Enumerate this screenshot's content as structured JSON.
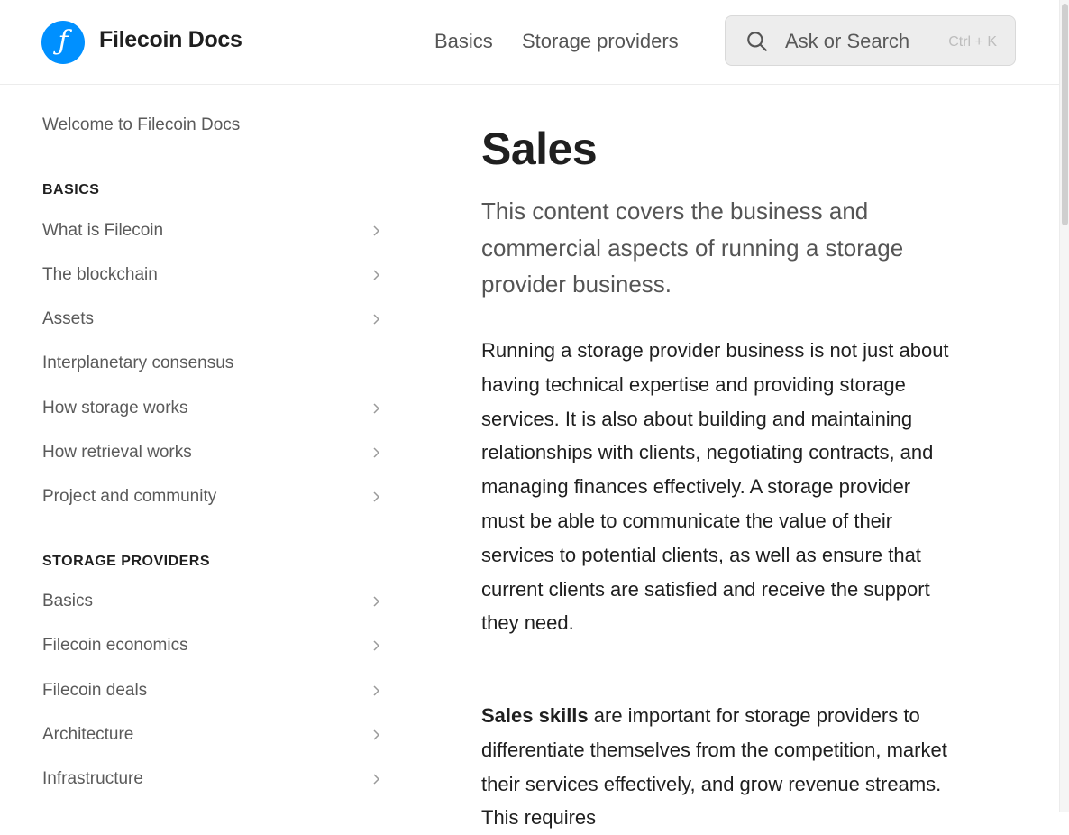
{
  "header": {
    "brand": "Filecoin Docs",
    "logo_glyph": "ƒ",
    "nav": [
      "Basics",
      "Storage providers"
    ],
    "search_placeholder": "Ask or Search",
    "search_shortcut": "Ctrl + K"
  },
  "sidebar": {
    "welcome": "Welcome to Filecoin Docs",
    "sections": [
      {
        "heading": "BASICS",
        "items": [
          {
            "label": "What is Filecoin",
            "has_children": true
          },
          {
            "label": "The blockchain",
            "has_children": true
          },
          {
            "label": "Assets",
            "has_children": true
          },
          {
            "label": "Interplanetary consensus",
            "has_children": false
          },
          {
            "label": "How storage works",
            "has_children": true
          },
          {
            "label": "How retrieval works",
            "has_children": true
          },
          {
            "label": "Project and community",
            "has_children": true
          }
        ]
      },
      {
        "heading": "STORAGE PROVIDERS",
        "items": [
          {
            "label": "Basics",
            "has_children": true
          },
          {
            "label": "Filecoin economics",
            "has_children": true
          },
          {
            "label": "Filecoin deals",
            "has_children": true
          },
          {
            "label": "Architecture",
            "has_children": true
          },
          {
            "label": "Infrastructure",
            "has_children": true
          }
        ]
      }
    ]
  },
  "content": {
    "title": "Sales",
    "lead": "This content covers the business and commercial aspects of running a storage provider business.",
    "paragraph1": "Running a storage provider business is not just about having technical expertise and providing storage services. It is also about building and maintaining relationships with clients, negotiating contracts, and managing finances effectively. A storage provider must be able to communicate the value of their services to potential clients, as well as ensure that current clients are satisfied and receive the support they need.",
    "paragraph2_bold": "Sales skills",
    "paragraph2_rest": " are important for storage providers to differentiate themselves from the competition, market their services effectively, and grow revenue streams. This requires"
  },
  "colors": {
    "accent": "#0090ff",
    "text": "#1f1f1f",
    "muted": "#5a5a5a"
  },
  "icons": {
    "search": "search-icon",
    "chevron": "chevron-right-icon"
  }
}
